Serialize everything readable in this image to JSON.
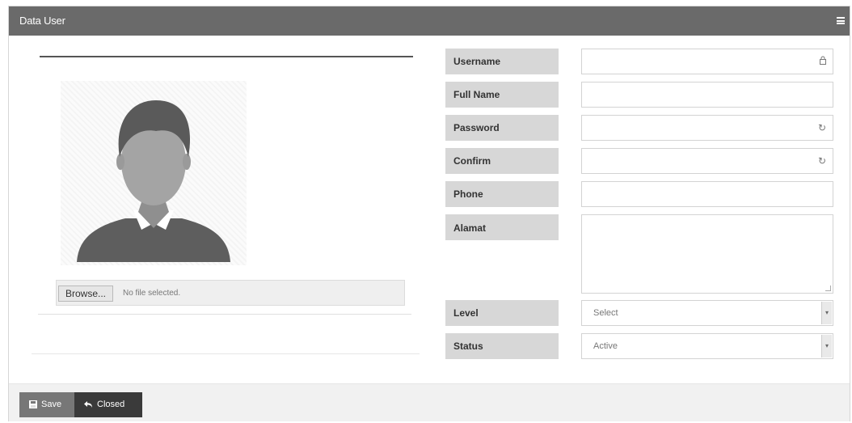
{
  "panel": {
    "title": "Data User"
  },
  "upload": {
    "browse_label": "Browse...",
    "status_text": "No file selected."
  },
  "form": {
    "username_label": "Username",
    "fullname_label": "Full Name",
    "password_label": "Password",
    "confirm_label": "Confirm",
    "phone_label": "Phone",
    "alamat_label": "Alamat",
    "level_label": "Level",
    "status_label": "Status",
    "username_value": "",
    "fullname_value": "",
    "password_value": "",
    "confirm_value": "",
    "phone_value": "",
    "alamat_value": "",
    "level_selected": "Select",
    "status_selected": "Active"
  },
  "footer": {
    "save_label": "Save",
    "close_label": "Closed"
  },
  "colors": {
    "header_bg": "#6a6a6a",
    "label_bg": "#d7d7d7",
    "save_bg": "#777777",
    "close_bg": "#3a3a3a"
  },
  "icons": [
    "menu-icon",
    "user-avatar",
    "lock-icon",
    "refresh-icon",
    "save-icon",
    "undo-icon"
  ]
}
